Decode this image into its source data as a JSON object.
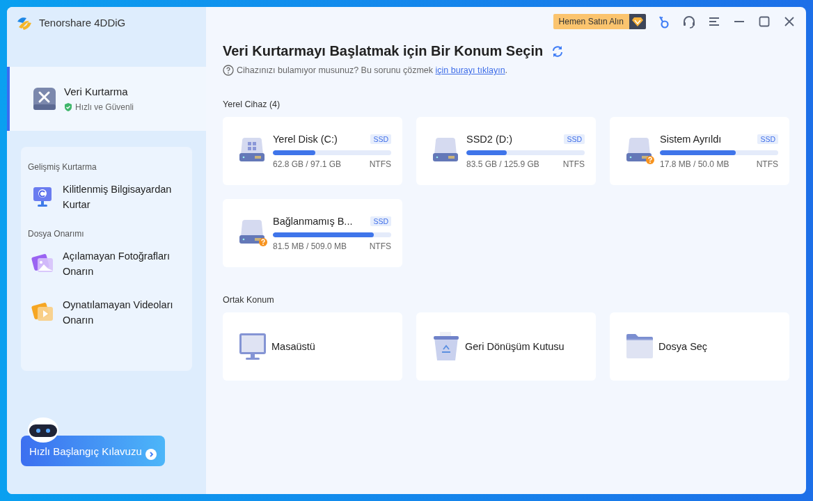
{
  "app": {
    "name": "Tenorshare 4DDiG"
  },
  "sidebar": {
    "items": [
      {
        "label": "Veri Kurtarma",
        "subtitle": "Hızlı ve Güvenli",
        "selected": true
      }
    ],
    "panel": {
      "sections": [
        {
          "title": "Gelişmiş Kurtarma",
          "items": [
            {
              "kind": "computer",
              "label": "Kilitlenmiş Bilgisayardan Kurtar",
              "selected": false
            }
          ]
        },
        {
          "title": "Dosya Onarımı",
          "items": [
            {
              "kind": "photo",
              "label": "Açılamayan Fotoğrafları Onarın",
              "selected": false
            },
            {
              "kind": "video",
              "label": "Oynatılamayan Videoları Onarın",
              "selected": false
            }
          ]
        }
      ]
    },
    "guide_button": "Hızlı Başlangıç Kılavuzu"
  },
  "toolbar": {
    "buy_button": "Hemen Satın Alın"
  },
  "main": {
    "title": "Veri Kurtarmayı Başlatmak için Bir Konum Seçin",
    "help": {
      "text": "Cihazınızı bulamıyor musunuz? Bu sorunu çözmek ",
      "link": "için burayı tıklayın",
      "end": "."
    },
    "local_devices": {
      "title": "Yerel Cihaz (4)",
      "drives": [
        {
          "kind": "system",
          "name": "Yerel Disk (C:)",
          "tag": "SSD",
          "level": 0.36,
          "usage": "62.8 GB / 97.1 GB",
          "filesystem": "NTFS"
        },
        {
          "kind": "plain",
          "name": "SSD2 (D:)",
          "tag": "SSD",
          "level": 0.34,
          "usage": "83.5 GB / 125.9 GB",
          "filesystem": "NTFS"
        },
        {
          "kind": "unknown",
          "name": "Sistem Ayrıldı",
          "tag": "SSD",
          "level": 0.64,
          "usage": "17.8 MB / 50.0 MB",
          "filesystem": "NTFS"
        },
        {
          "kind": "unknown",
          "name": "Bağlanmamış B...",
          "tag": "SSD",
          "level": 0.85,
          "usage": "81.5 MB / 509.0 MB",
          "filesystem": "NTFS"
        }
      ]
    },
    "common_locations": {
      "title": "Ortak Konum",
      "items": [
        {
          "kind": "desktop",
          "label": "Masaüstü"
        },
        {
          "kind": "recycle",
          "label": "Geri Dönüşüm Kutusu"
        },
        {
          "kind": "folder",
          "label": "Dosya Seç"
        }
      ]
    }
  }
}
